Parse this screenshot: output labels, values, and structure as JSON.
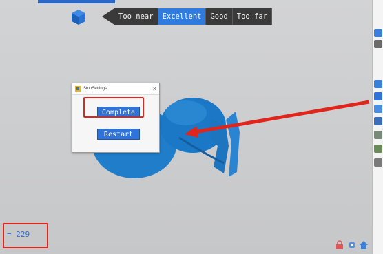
{
  "distance_indicator": {
    "options": [
      "Too near",
      "Excellent",
      "Good",
      "Too far"
    ],
    "selected": "Excellent"
  },
  "dialog": {
    "title": "StopSettings",
    "complete_label": "Complete",
    "restart_label": "Restart"
  },
  "counter": {
    "text": "= 229"
  },
  "icons": {
    "view_cube": "view-cube-icon",
    "dialog_app": "app-icon",
    "close": "close-icon",
    "right_tools": [
      "flag-icon",
      "minus-icon",
      "flag-icon",
      "square-icon",
      "rotate-icon",
      "layers-icon",
      "grid-icon",
      "chart-icon",
      "download-icon"
    ],
    "status": [
      "lock-icon",
      "settings-icon",
      "home-icon"
    ]
  },
  "colors": {
    "accent": "#2f7be0",
    "model": "#1f7dc9",
    "highlight": "#e0251c",
    "background": "#cfd0d2"
  }
}
